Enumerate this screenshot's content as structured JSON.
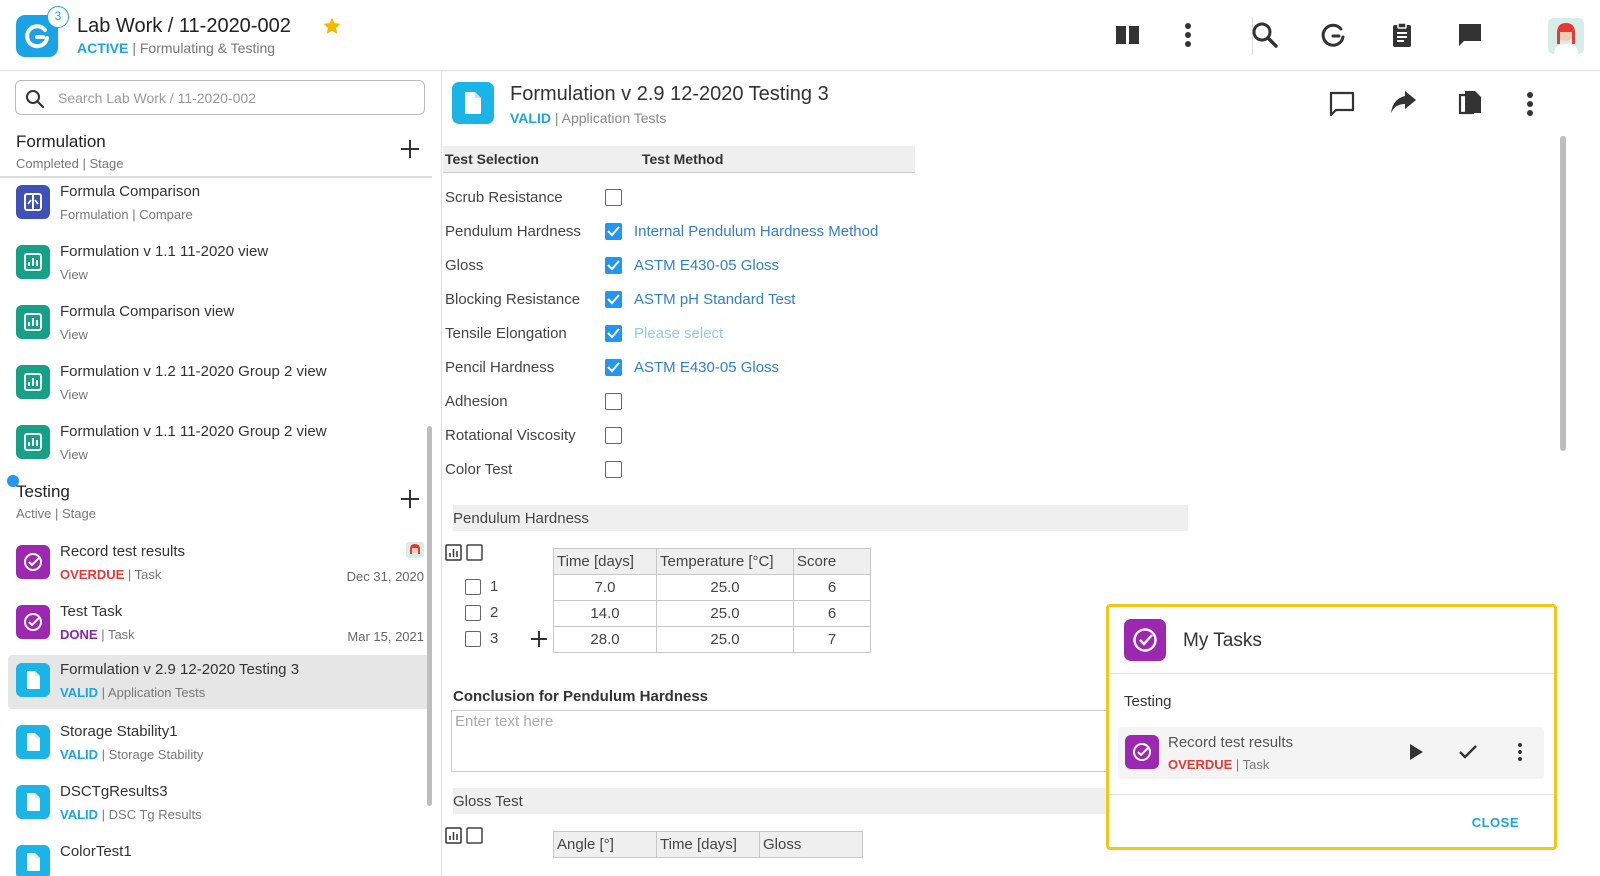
{
  "header": {
    "notification_count": "3",
    "title": "Lab Work / 11-2020-002",
    "status": "ACTIVE",
    "subtitle": "| Formulating & Testing"
  },
  "sidebar": {
    "search_placeholder": "Search Lab Work / 11-2020-002",
    "formulation_section": {
      "title": "Formulation",
      "subtitle": "Completed | Stage"
    },
    "formulation_items": [
      {
        "title": "Formula Comparison",
        "subtitle": "Formulation | Compare"
      },
      {
        "title": "Formulation v 1.1 11-2020 view",
        "subtitle": "View"
      },
      {
        "title": "Formula Comparison view",
        "subtitle": "View"
      },
      {
        "title": "Formulation v 1.2 11-2020 Group 2 view",
        "subtitle": "View"
      },
      {
        "title": "Formulation v 1.1 11-2020 Group 2 view",
        "subtitle": "View"
      }
    ],
    "testing_section": {
      "title": "Testing",
      "subtitle": "Active | Stage"
    },
    "testing_items": [
      {
        "title": "Record test results",
        "status": "OVERDUE",
        "type": "| Task",
        "date": "Dec 31, 2020"
      },
      {
        "title": "Test Task",
        "status": "DONE",
        "type": "| Task",
        "date": "Mar 15, 2021"
      },
      {
        "title": "Formulation v 2.9 12-2020 Testing 3",
        "status": "VALID",
        "type": "|  Application Tests"
      },
      {
        "title": "Storage Stability1",
        "status": "VALID",
        "type": "|  Storage Stability"
      },
      {
        "title": "DSCTgResults3",
        "status": "VALID",
        "type": "|  DSC Tg Results"
      },
      {
        "title": "ColorTest1"
      }
    ]
  },
  "main": {
    "title": "Formulation v 2.9 12-2020 Testing 3",
    "status": "VALID",
    "subtitle": "|  Application Tests",
    "test_selection": {
      "headers": [
        "Test Selection",
        "Test Method"
      ],
      "rows": [
        {
          "name": "Scrub Resistance",
          "checked": false,
          "method": ""
        },
        {
          "name": "Pendulum Hardness",
          "checked": true,
          "method": "Internal Pendulum Hardness Method"
        },
        {
          "name": "Gloss",
          "checked": true,
          "method": "ASTM E430-05 Gloss"
        },
        {
          "name": "Blocking Resistance",
          "checked": true,
          "method": "ASTM pH Standard Test"
        },
        {
          "name": "Tensile Elongation",
          "checked": true,
          "method": "Please select"
        },
        {
          "name": "Pencil Hardness",
          "checked": true,
          "method": "ASTM E430-05 Gloss"
        },
        {
          "name": "Adhesion",
          "checked": false,
          "method": ""
        },
        {
          "name": "Rotational Viscosity",
          "checked": false,
          "method": ""
        },
        {
          "name": "Color Test",
          "checked": false,
          "method": ""
        }
      ]
    },
    "pendulum": {
      "title": "Pendulum Hardness",
      "headers": [
        "Time [days]",
        "Temperature [°C]",
        "Score"
      ],
      "rows": [
        {
          "label": "1",
          "values": [
            "7.0",
            "25.0",
            "6"
          ]
        },
        {
          "label": "2",
          "values": [
            "14.0",
            "25.0",
            "6"
          ]
        },
        {
          "label": "3",
          "values": [
            "28.0",
            "25.0",
            "7"
          ]
        }
      ]
    },
    "conclusion": {
      "label": "Conclusion for Pendulum Hardness",
      "placeholder": "Enter text here"
    },
    "gloss": {
      "title": "Gloss Test",
      "headers": [
        "Angle [°]",
        "Time [days]",
        "Gloss"
      ]
    }
  },
  "tasks_panel": {
    "title": "My Tasks",
    "group": "Testing",
    "item": {
      "title": "Record test results",
      "status": "OVERDUE",
      "type": "| Task"
    },
    "close_label": "CLOSE"
  },
  "colors": {
    "accent": "#1aa4e6",
    "task": "#9c27b0",
    "view": "#16a085",
    "compare": "#3f51b5",
    "overdue": "#e53935",
    "highlight": "#f5c518"
  }
}
